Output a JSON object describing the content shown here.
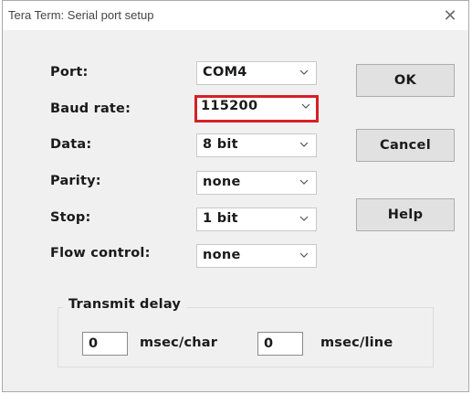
{
  "window": {
    "title": "Tera Term: Serial port setup",
    "close_glyph": "✕"
  },
  "fields": [
    {
      "label": "Port:",
      "value": "COM4"
    },
    {
      "label": "Baud rate:",
      "value": "115200"
    },
    {
      "label": "Data:",
      "value": "8 bit"
    },
    {
      "label": "Parity:",
      "value": "none"
    },
    {
      "label": "Stop:",
      "value": "1 bit"
    },
    {
      "label": "Flow control:",
      "value": "none"
    }
  ],
  "buttons": {
    "ok": "OK",
    "cancel": "Cancel",
    "help": "Help"
  },
  "transmit_delay": {
    "title": "Transmit delay",
    "char_value": "0",
    "char_unit": "msec/char",
    "line_value": "0",
    "line_unit": "msec/line"
  },
  "colors": {
    "highlight": "#d61f26",
    "dialog_bg": "#f0f0f0",
    "button_bg": "#e1e1e1"
  },
  "icons": {
    "dropdown": "chevron-down-icon",
    "close": "close-icon"
  }
}
